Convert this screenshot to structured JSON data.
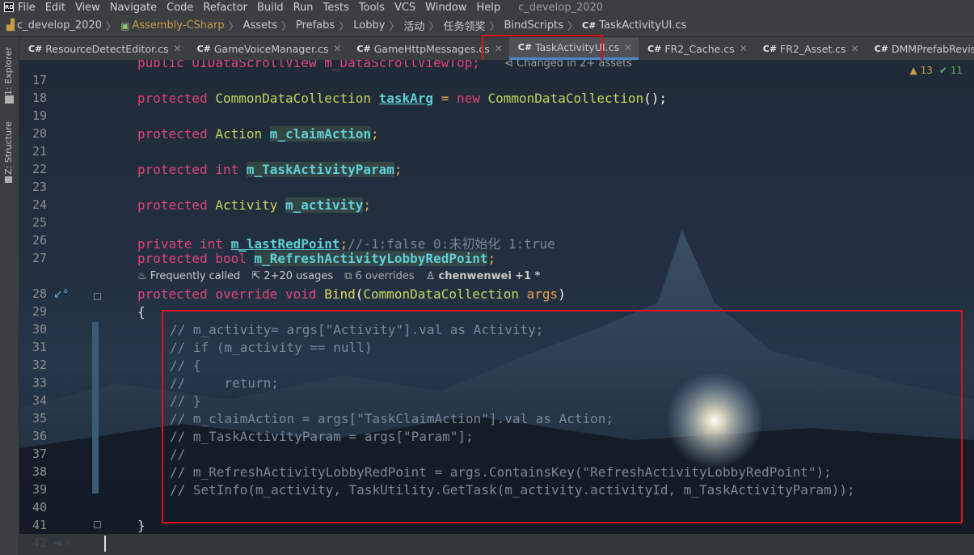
{
  "menu": {
    "items": [
      "File",
      "Edit",
      "View",
      "Navigate",
      "Code",
      "Refactor",
      "Build",
      "Run",
      "Tests",
      "Tools",
      "VCS",
      "Window",
      "Help"
    ],
    "project_title": "c_develop_2020"
  },
  "breadcrumb": [
    "c_develop_2020",
    "Assembly-CSharp",
    "Assets",
    "Prefabs",
    "Lobby",
    "活动",
    "任务领奖",
    "BindScripts",
    "TaskActivityUI.cs"
  ],
  "tabs": [
    {
      "label": "ResourceDetectEditor.cs"
    },
    {
      "label": "GameVoiceManager.cs"
    },
    {
      "label": "GameHttpMessages.cs"
    },
    {
      "label": "TaskActivityUI.cs",
      "active": true
    },
    {
      "label": "FR2_Cache.cs"
    },
    {
      "label": "FR2_Asset.cs"
    },
    {
      "label": "DMMPrefabRevisionWindow.cs"
    }
  ],
  "toolwindows": {
    "explorer": "1: Explorer",
    "structure": "Z: Structure"
  },
  "editor": {
    "changed_hint": "Changed in 2+ assets",
    "warnings": "13",
    "ok_count": "11",
    "line_numbers": [
      "17",
      "18",
      "19",
      "20",
      "21",
      "22",
      "23",
      "24",
      "25",
      "26",
      "27",
      "28",
      "29",
      "30",
      "31",
      "32",
      "33",
      "34",
      "35",
      "36",
      "37",
      "38",
      "39",
      "40",
      "41",
      "42"
    ],
    "top_partial": "public UIDataScrollView m_DataScrollViewTop;",
    "code": {
      "l18a": "protected ",
      "l18b": "CommonDataCollection ",
      "l18c": "taskArg",
      "l18d": " = ",
      "l18e": "new ",
      "l18f": "CommonDataCollection",
      "l18g": "();",
      "l20a": "protected ",
      "l20b": "Action ",
      "l20c": "m_claimAction",
      "l20d": ";",
      "l22a": "protected int ",
      "l22c": "m_TaskActivityParam",
      "l22d": ";",
      "l24a": "protected ",
      "l24b": "Activity ",
      "l24c": "m_activity",
      "l24d": ";",
      "l26a": "private int ",
      "l26c": "m_lastRedPoint",
      "l26d": ";",
      "l26e": "//-1:false 0:未初始化 1:true",
      "l27a": "protected bool ",
      "l27c": "m_RefreshActivityLobbyRedPoint",
      "l27d": ";",
      "l28a": "protected override void ",
      "l28b": "Bind",
      "l28c": "(",
      "l28d": "CommonDataCollection ",
      "l28e": "args",
      "l28f": ")",
      "l29": "{",
      "l30": "// m_activity= args[\"Activity\"].val as Activity;",
      "l31": "// if (m_activity == null)",
      "l32": "// {",
      "l33": "//     return;",
      "l34": "// }",
      "l35": "// m_claimAction = args[\"TaskClaimAction\"].val as Action;",
      "l36": "// m_TaskActivityParam = args[\"Param\"];",
      "l37": "//",
      "l38": "// m_RefreshActivityLobbyRedPoint = args.ContainsKey(\"RefreshActivityLobbyRedPoint\");",
      "l39": "// SetInfo(m_activity, TaskUtility.GetTask(m_activity.activityId, m_TaskActivityParam));",
      "l41": "}"
    },
    "hints": {
      "frequently": "Frequently called",
      "usages": "2+20 usages",
      "overrides": "6 overrides",
      "author": "chenwenwei",
      "author_extra": "+1 *"
    }
  }
}
